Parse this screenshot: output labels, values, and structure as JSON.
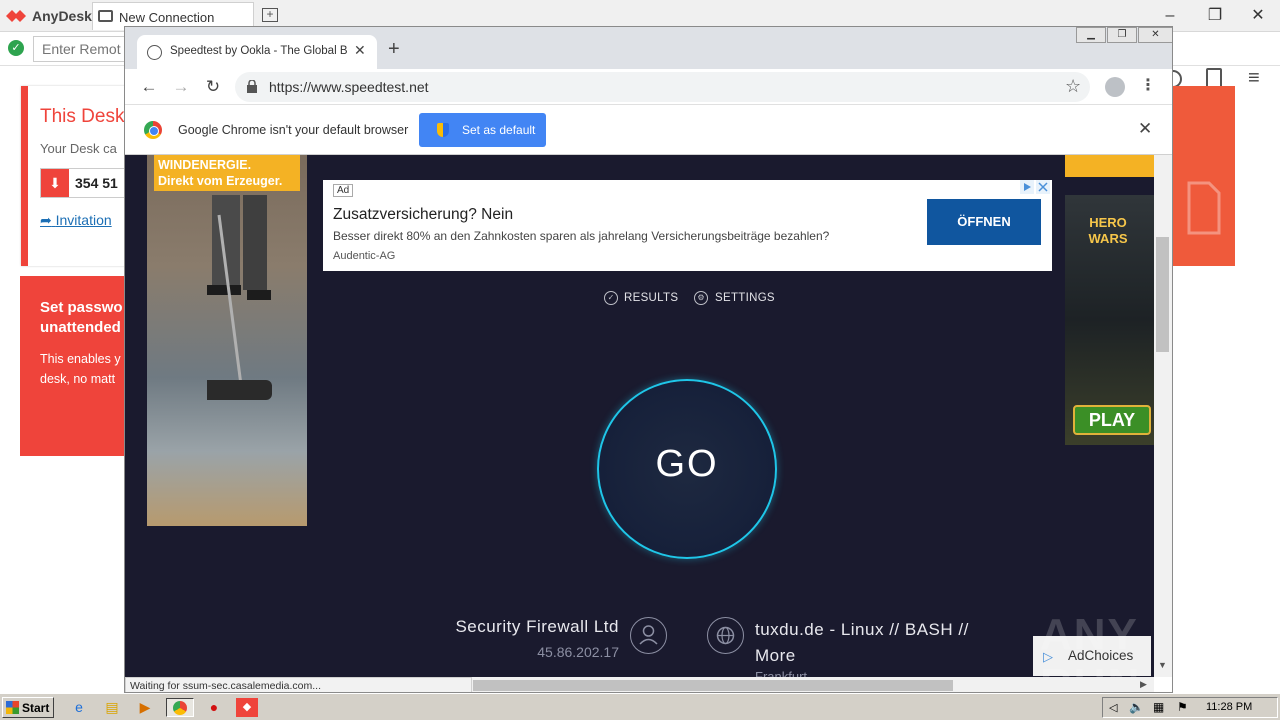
{
  "anydesk": {
    "app_name": "AnyDesk",
    "tab_label": "New Connection",
    "remote_input_placeholder": "Enter Remot",
    "card1_title": "This Desk",
    "card1_sub": "Your Desk ca",
    "id_number": "354 51",
    "invite_label": "Invitation",
    "card2_title_line1": "Set passwo",
    "card2_title_line2": "unattended",
    "card2_text_line1": "This enables y",
    "card2_text_line2": "desk, no matt",
    "brand_color": "#ef443b"
  },
  "chrome": {
    "tab_title": "Speedtest by Ookla - The Global Bro",
    "url": "https://www.speedtest.net",
    "infobar_text": "Google Chrome isn't your default browser",
    "set_default_label": "Set as default",
    "status_text": "Waiting for ssum-sec.casalemedia.com..."
  },
  "ads": {
    "left_banner_line1": "WINDENERGIE.",
    "left_banner_line2": "Direkt vom Erzeuger.",
    "right_banner_logo_line1": "HERO",
    "right_banner_logo_line2": "WARS",
    "right_banner_cta": "PLAY",
    "text_ad_badge": "Ad",
    "text_ad_title": "Zusatzversicherung? Nein",
    "text_ad_desc": "Besser direkt 80% an den Zahnkosten sparen als jahrelang Versicherungsbeiträge bezahlen?",
    "text_ad_advertiser": "Audentic-AG",
    "text_ad_button": "ÖFFNEN",
    "adchoices_label": "AdChoices"
  },
  "speedtest": {
    "nav_results": "RESULTS",
    "nav_settings": "SETTINGS",
    "go_label": "GO",
    "isp_name": "Security Firewall Ltd",
    "isp_ip": "45.86.202.17",
    "server_name": "tuxdu.de - Linux // BASH // More",
    "server_location": "Frankfurt",
    "accent_color": "#1fc6e8",
    "background_color": "#1a1a2e"
  },
  "watermark": "ANY RUN",
  "taskbar": {
    "start_label": "Start",
    "clock": "11:28 PM"
  }
}
